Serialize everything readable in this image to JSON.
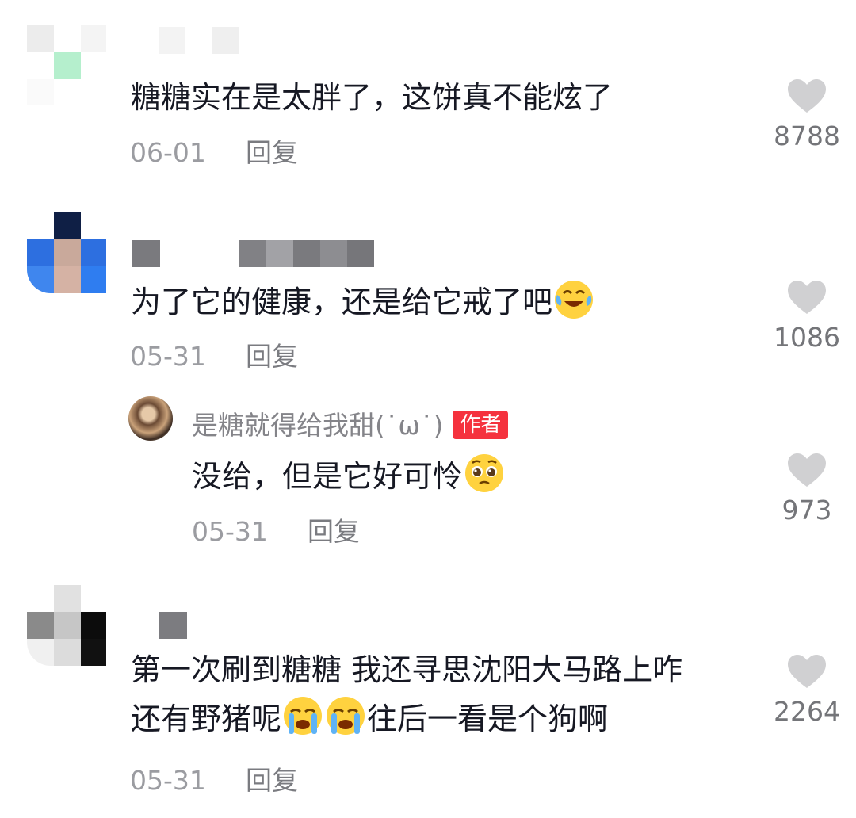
{
  "comments": [
    {
      "text": "糖糖实在是太胖了，这饼真不能炫了",
      "date": "06-01",
      "reply_label": "回复",
      "like_count": "8788",
      "like_icon": "heart-icon"
    },
    {
      "text": "为了它的健康，还是给它戒了吧",
      "emoji": "laughing-tears-emoji",
      "date": "05-31",
      "reply_label": "回复",
      "like_count": "1086",
      "like_icon": "heart-icon",
      "reply": {
        "author": "是糖就得给我甜(˙ω˙)",
        "badge": "作者",
        "text": "没给，但是它好可怜",
        "emoji": "pleading-face-emoji",
        "date": "05-31",
        "reply_label": "回复",
        "like_count": "973",
        "like_icon": "heart-icon"
      }
    },
    {
      "text_line1": "第一次刷到糖糖 我还寻思沈阳大马路上咋",
      "text_line2_before": "还有野猪呢",
      "emoji": "crying-face-emoji",
      "text_line2_after": "往后一看是个狗啊",
      "date": "05-31",
      "reply_label": "回复",
      "like_count": "2264",
      "like_icon": "heart-icon"
    }
  ],
  "colors": {
    "text": "#161823",
    "meta": "#9b9ca1",
    "like_icon": "#d0d0d2",
    "author_badge": "#f5323e"
  }
}
